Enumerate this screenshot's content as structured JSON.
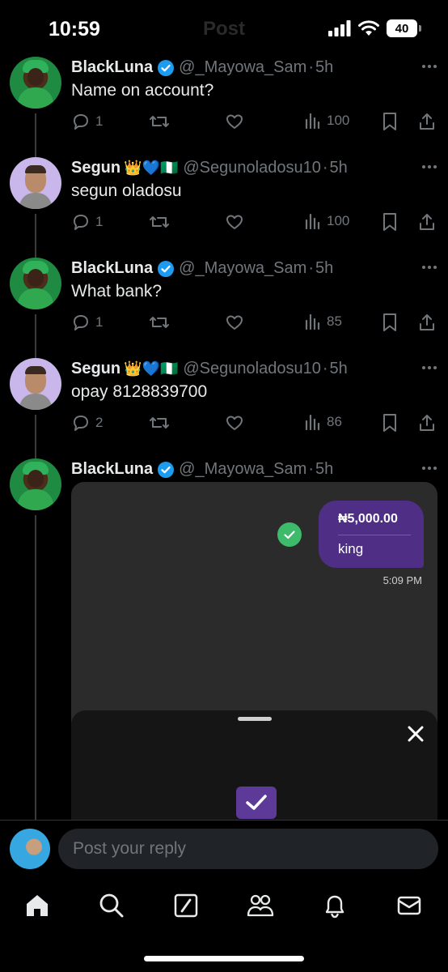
{
  "status": {
    "time": "10:59",
    "battery": "40"
  },
  "header": {
    "title": "Post"
  },
  "tweets": [
    {
      "name": "BlackLuna",
      "emojis": "",
      "handle": "@_Mayowa_Sam",
      "sep": "·",
      "time": "5h",
      "text": "Name on account?",
      "replies": "1",
      "views": "100"
    },
    {
      "name": "Segun",
      "emojis": "👑💙🇳🇬",
      "handle": "@Segunoladosu10",
      "sep": "·",
      "time": "5h",
      "text": "segun oladosu",
      "replies": "1",
      "views": "100"
    },
    {
      "name": "BlackLuna",
      "emojis": "",
      "handle": "@_Mayowa_Sam",
      "sep": "·",
      "time": "5h",
      "text": "What bank?",
      "replies": "1",
      "views": "85"
    },
    {
      "name": "Segun",
      "emojis": "👑💙🇳🇬",
      "handle": "@Segunoladosu10",
      "sep": "·",
      "time": "5h",
      "text": "opay 8128839700",
      "replies": "2",
      "views": "86"
    },
    {
      "name": "BlackLuna",
      "emojis": "",
      "handle": "@_Mayowa_Sam",
      "sep": "·",
      "time": "5h"
    }
  ],
  "media": {
    "amount": "₦5,000.00",
    "note": "king",
    "time": "5:09 PM"
  },
  "reply": {
    "placeholder": "Post your reply"
  },
  "nav": [
    {
      "icon": "home-icon"
    },
    {
      "icon": "search-icon"
    },
    {
      "icon": "grok-icon"
    },
    {
      "icon": "communities-icon"
    },
    {
      "icon": "notifications-icon"
    },
    {
      "icon": "messages-icon"
    }
  ]
}
